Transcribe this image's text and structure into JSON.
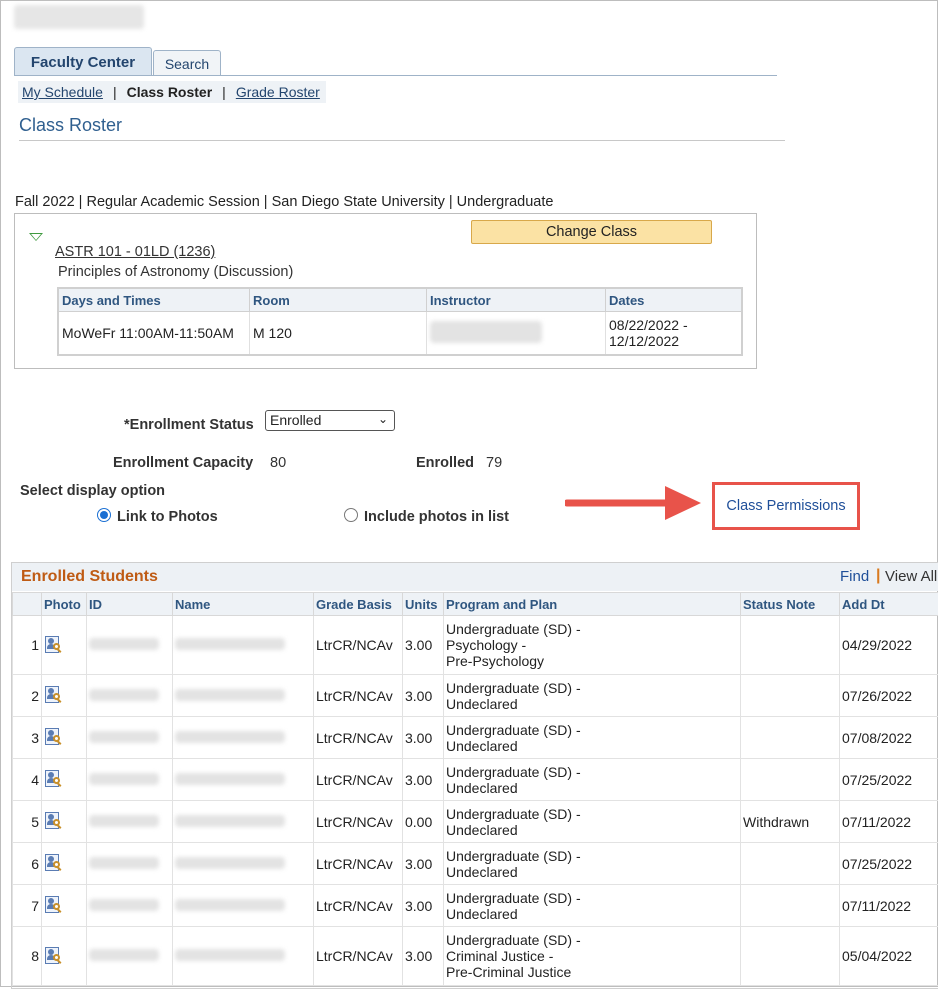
{
  "tabs": [
    {
      "label": "Faculty Center"
    },
    {
      "label": "Search"
    }
  ],
  "subnav": {
    "my_schedule": "My Schedule",
    "class_roster": "Class Roster",
    "grade_roster": "Grade Roster",
    "separator": "|"
  },
  "page_title": "Class Roster",
  "term_line": "Fall 2022 | Regular Academic Session | San Diego State University | Undergraduate",
  "class": {
    "link": "ASTR 101 - 01LD (1236)",
    "description": "Principles of Astronomy (Discussion)",
    "change_button": "Change Class",
    "meeting_headers": [
      "Days and Times",
      "Room",
      "Instructor",
      "Dates"
    ],
    "meeting": {
      "days_times": "MoWeFr 11:00AM-11:50AM",
      "room": "M 120",
      "dates_line1": "08/22/2022 -",
      "dates_line2": "12/12/2022"
    }
  },
  "enrollment": {
    "status_label": "*Enrollment Status",
    "status_value": "Enrolled",
    "capacity_label": "Enrollment Capacity",
    "capacity_value": "80",
    "enrolled_label": "Enrolled",
    "enrolled_value": "79"
  },
  "display_option": {
    "label": "Select display option",
    "link_to_photos": "Link to Photos",
    "include_photos": "Include photos in list",
    "selected": "link_to_photos"
  },
  "class_permissions": "Class Permissions",
  "highlight_color": "#e8534a",
  "grid": {
    "title": "Enrolled Students",
    "find": "Find",
    "separator": "|",
    "view_all": "View All",
    "headers": [
      "Photo",
      "ID",
      "Name",
      "Grade Basis",
      "Units",
      "Program and Plan",
      "Status Note",
      "Add Dt"
    ],
    "rows": [
      {
        "n": "1",
        "grade": "LtrCR/NCAv",
        "units": "3.00",
        "p1": "Undergraduate (SD) -",
        "p2": "Psychology -",
        "p3": "Pre-Psychology",
        "note": "",
        "date": "04/29/2022"
      },
      {
        "n": "2",
        "grade": "LtrCR/NCAv",
        "units": "3.00",
        "p1": "Undergraduate (SD) -",
        "p2": "Undeclared",
        "p3": "",
        "note": "",
        "date": "07/26/2022"
      },
      {
        "n": "3",
        "grade": "LtrCR/NCAv",
        "units": "3.00",
        "p1": "Undergraduate (SD) -",
        "p2": "Undeclared",
        "p3": "",
        "note": "",
        "date": "07/08/2022"
      },
      {
        "n": "4",
        "grade": "LtrCR/NCAv",
        "units": "3.00",
        "p1": "Undergraduate (SD) -",
        "p2": "Undeclared",
        "p3": "",
        "note": "",
        "date": "07/25/2022"
      },
      {
        "n": "5",
        "grade": "LtrCR/NCAv",
        "units": "0.00",
        "p1": "Undergraduate (SD) -",
        "p2": "Undeclared",
        "p3": "",
        "note": "Withdrawn",
        "date": "07/11/2022"
      },
      {
        "n": "6",
        "grade": "LtrCR/NCAv",
        "units": "3.00",
        "p1": "Undergraduate (SD) -",
        "p2": "Undeclared",
        "p3": "",
        "note": "",
        "date": "07/25/2022"
      },
      {
        "n": "7",
        "grade": "LtrCR/NCAv",
        "units": "3.00",
        "p1": "Undergraduate (SD) -",
        "p2": "Undeclared",
        "p3": "",
        "note": "",
        "date": "07/11/2022"
      },
      {
        "n": "8",
        "grade": "LtrCR/NCAv",
        "units": "3.00",
        "p1": "Undergraduate (SD) -",
        "p2": "Criminal Justice -",
        "p3": "Pre-Criminal Justice",
        "note": "",
        "date": "05/04/2022"
      }
    ]
  }
}
